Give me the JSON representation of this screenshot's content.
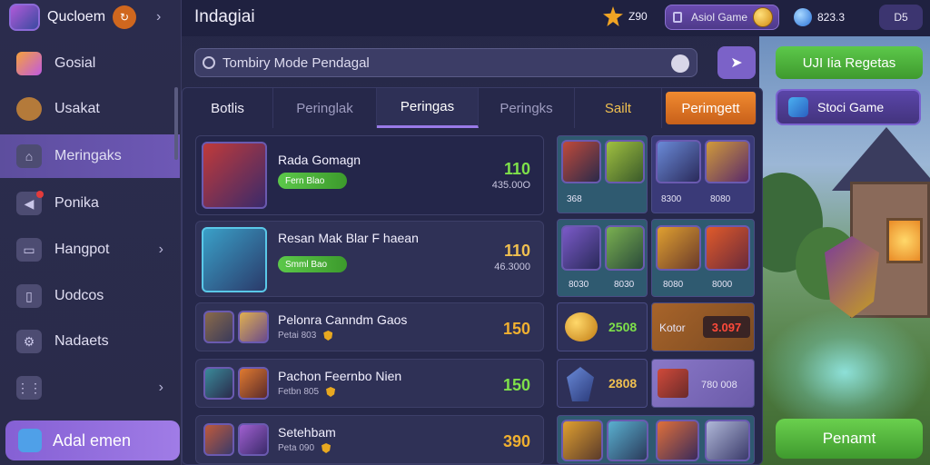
{
  "sidebar": {
    "profile_name": "Qucloem",
    "items": [
      {
        "label": "Gosial",
        "icon": "game-app-icon"
      },
      {
        "label": "Usakat",
        "icon": "coin-bag-icon"
      },
      {
        "label": "Meringaks",
        "icon": "home-icon"
      },
      {
        "label": "Ponika",
        "icon": "megaphone-icon"
      },
      {
        "label": "Hangpot",
        "icon": "inbox-icon"
      },
      {
        "label": "Uodcos",
        "icon": "door-icon"
      },
      {
        "label": "Nadaets",
        "icon": "settings-icon"
      },
      {
        "label": "",
        "icon": "grid-icon"
      }
    ],
    "bottom_button": "Adal emen"
  },
  "header": {
    "title": "Indagiai",
    "stars": "Z90",
    "game_pill": "Asiol Game",
    "gems": "823.3",
    "ds": "D5"
  },
  "search": {
    "value": "Tombiry Mode Pendagal"
  },
  "actions": {
    "green_top": "UJI Iia Regetas",
    "stoci": "Stoci Game",
    "bottom_green": "Penamt"
  },
  "tabs": [
    {
      "label": "Botlis",
      "state": "normal"
    },
    {
      "label": "Peringlak",
      "state": "normal"
    },
    {
      "label": "Peringas",
      "state": "active"
    },
    {
      "label": "Peringks",
      "state": "normal"
    },
    {
      "label": "Sailt",
      "state": "gold"
    },
    {
      "label": "Perimgett",
      "state": "orange"
    }
  ],
  "rows": [
    {
      "title": "Rada Gomagn",
      "pill": "Fern Blao",
      "value": "110",
      "value_color": "#7ee04a",
      "sub_value": "435.00O"
    },
    {
      "title": "Resan Mak Blar F haean",
      "pill": "Smml Bao",
      "value": "110",
      "value_color": "#f0c050",
      "sub_value": "46.3000"
    },
    {
      "title": "Pelonra Canndm Gaos",
      "sub": "Petai 803",
      "value": "150",
      "value_color": "#f0b030"
    },
    {
      "title": "Pachon Feernbo Nien",
      "sub": "Fetbn 805",
      "value": "150",
      "value_color": "#7ee04a"
    },
    {
      "title": "Setehbam",
      "sub": "Peta 090",
      "value": "390",
      "value_color": "#f0b030"
    }
  ],
  "grid": {
    "r1": [
      "368",
      "",
      "8300",
      "8080"
    ],
    "r2": [
      "8030",
      "8030",
      "8080",
      "8000"
    ],
    "r3_val": "2508",
    "r3_label": "Kotor",
    "r3_price": "3.097",
    "r4_val": "2808",
    "r4_price": "780 008"
  }
}
